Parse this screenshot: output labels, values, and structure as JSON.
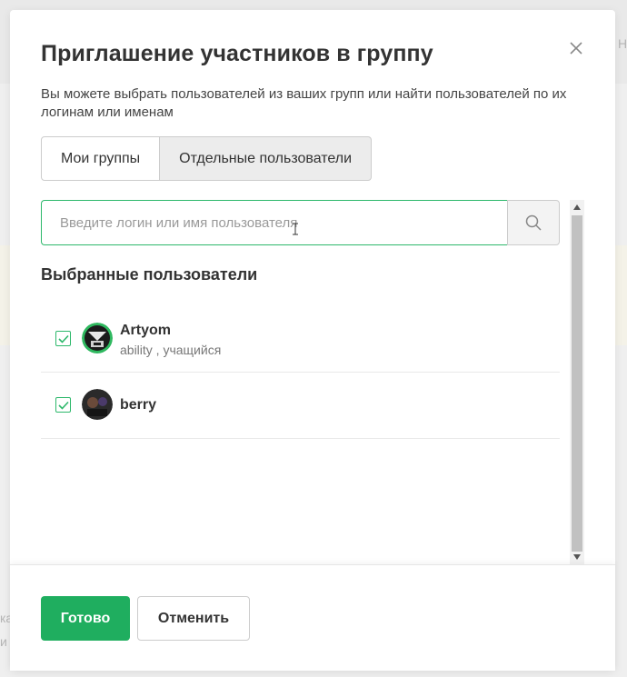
{
  "background": {
    "fragment_right": "Н",
    "fragment_left_1": "ка",
    "fragment_left_2": "и"
  },
  "modal": {
    "title": "Приглашение участников в группу",
    "close_icon": "close-icon",
    "description": "Вы можете выбрать пользователей из ваших групп или найти пользователей по их логинам или именам",
    "tabs": [
      {
        "label": "Мои группы",
        "active": false
      },
      {
        "label": "Отдельные пользователи",
        "active": true
      }
    ],
    "search": {
      "value": "",
      "placeholder": "Введите логин или имя пользователя",
      "icon": "search-icon"
    },
    "selected_title": "Выбранные пользователи",
    "users": [
      {
        "name": "Artyom",
        "meta": "ability , учащийся",
        "checked": true
      },
      {
        "name": "berry",
        "meta": "",
        "checked": true
      }
    ],
    "footer": {
      "done_label": "Готово",
      "cancel_label": "Отменить"
    }
  },
  "colors": {
    "accent": "#1fae5f",
    "input_focus_border": "#2db86b",
    "text": "#333333"
  }
}
